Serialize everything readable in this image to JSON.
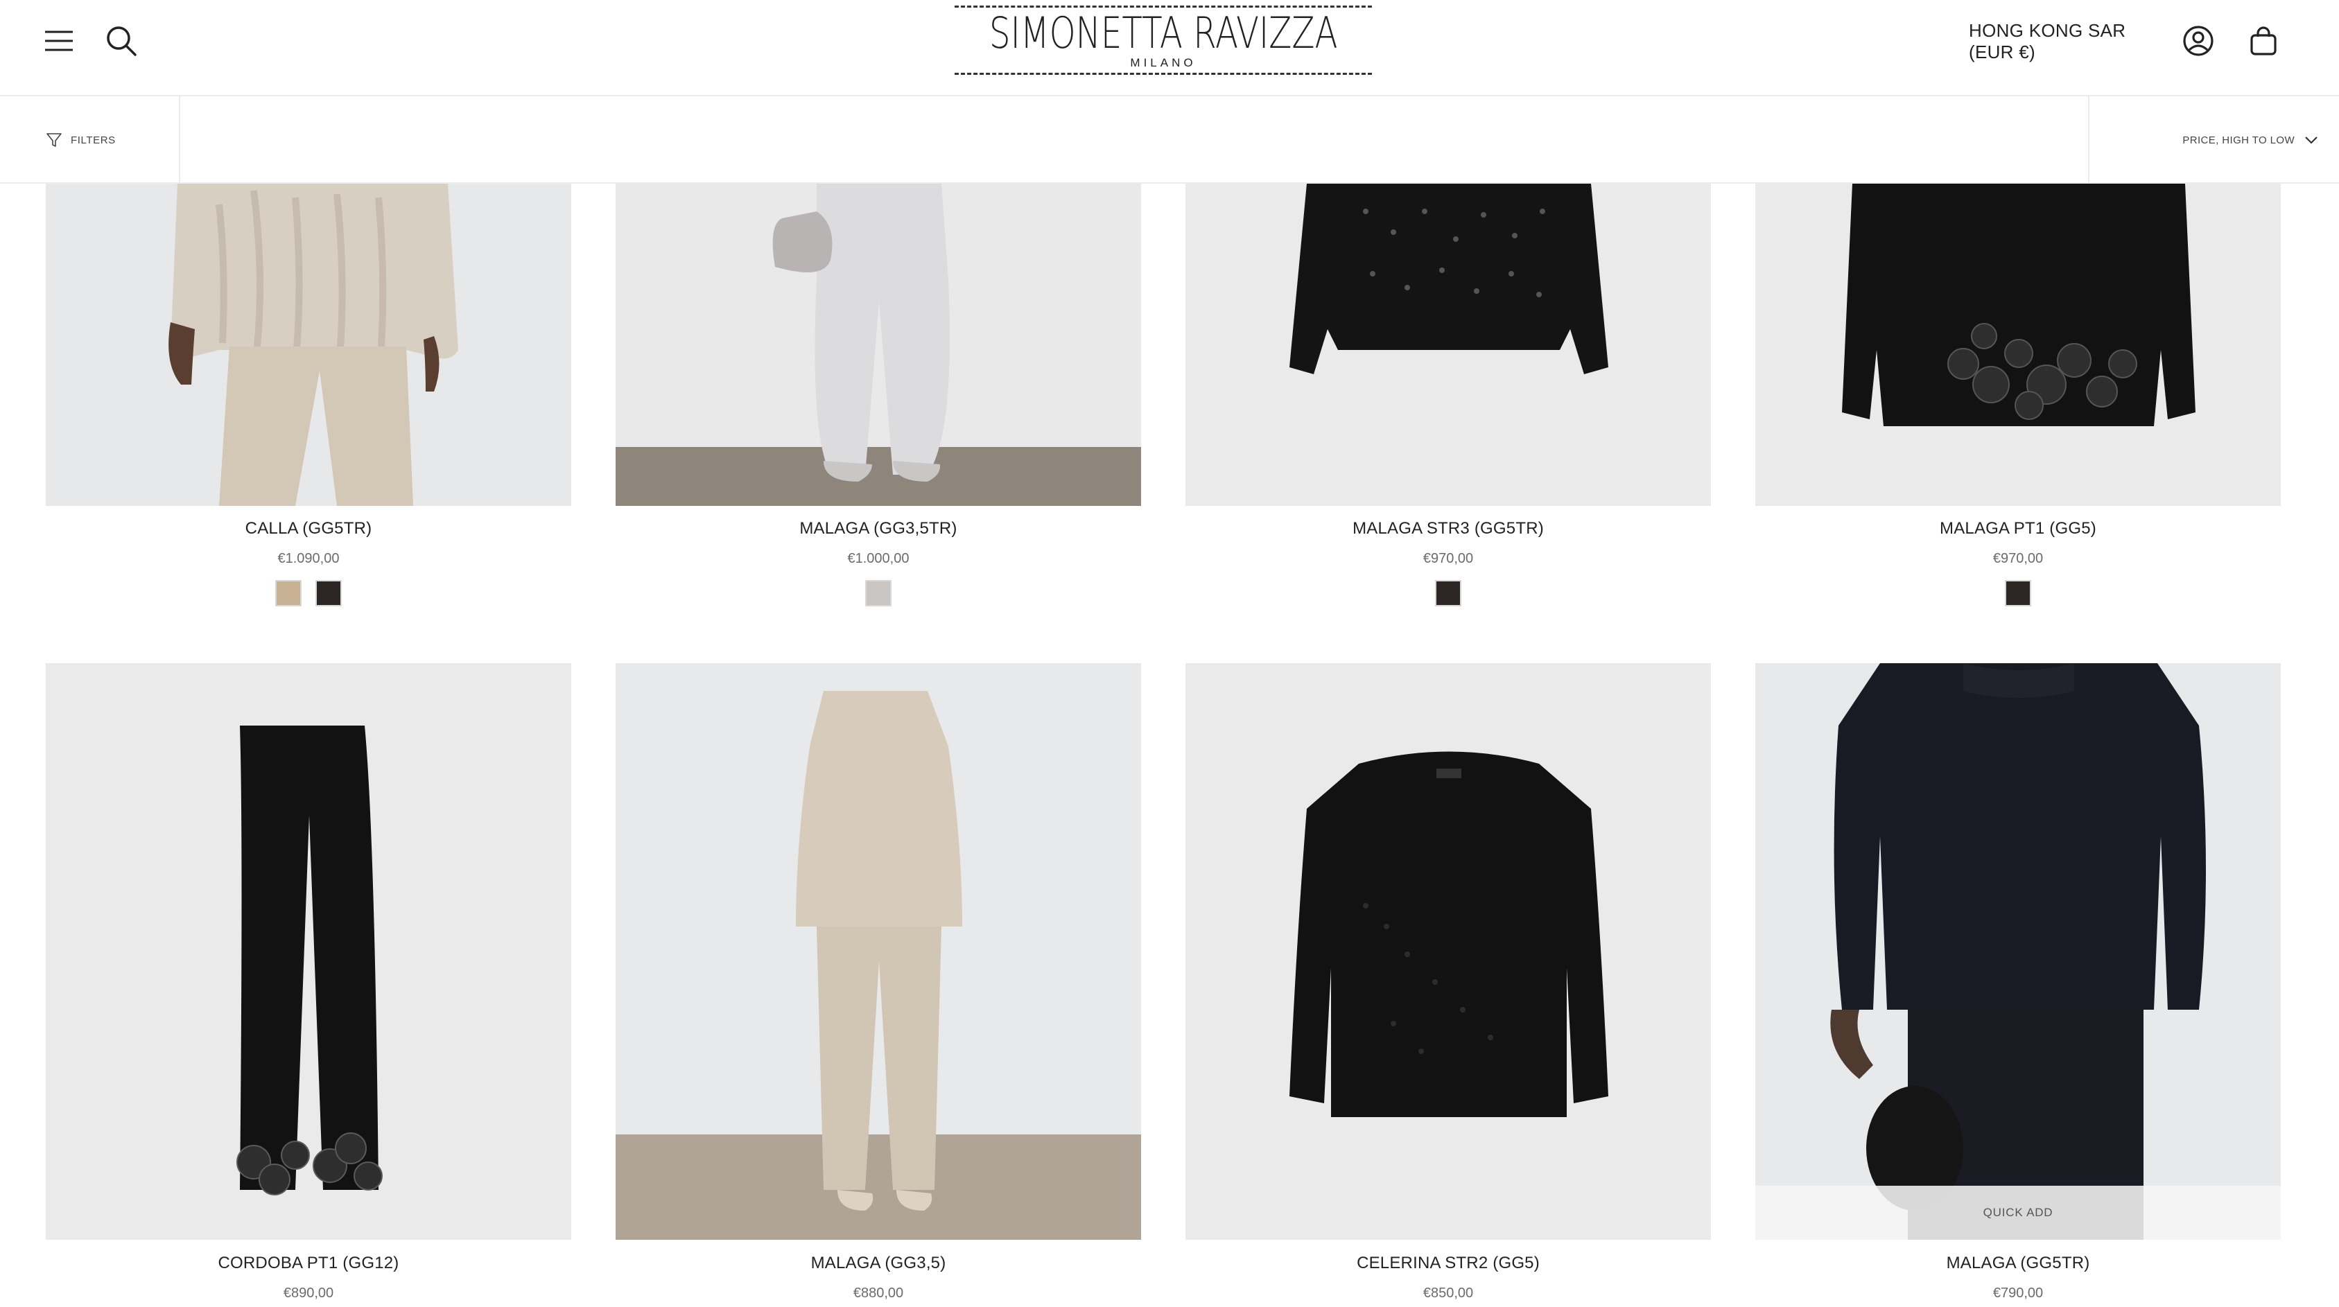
{
  "header": {
    "logo_main": "SIMONETTA RAVIZZA",
    "logo_sub": "MILANO",
    "region": "HONG KONG SAR (EUR €)",
    "icons": [
      "menu-icon",
      "search-icon",
      "account-icon",
      "cart-icon"
    ]
  },
  "toolbar": {
    "filters_label": "FILTERS",
    "sort_label": "PRICE, HIGH TO LOW"
  },
  "products": [
    {
      "name": "CALLA (GG5TR)",
      "price": "€1.090,00",
      "swatches": [
        "#c8b293",
        "#2b2623"
      ]
    },
    {
      "name": "MALAGA (GG3,5TR)",
      "price": "€1.000,00",
      "swatches": [
        "#c9c6c3"
      ]
    },
    {
      "name": "MALAGA STR3 (GG5TR)",
      "price": "€970,00",
      "swatches": [
        "#2b2623"
      ]
    },
    {
      "name": "MALAGA PT1 (GG5)",
      "price": "€970,00",
      "swatches": [
        "#2b2623"
      ]
    },
    {
      "name": "CORDOBA PT1 (GG12)",
      "price": "€890,00",
      "swatches": []
    },
    {
      "name": "MALAGA (GG3,5)",
      "price": "€880,00",
      "swatches": []
    },
    {
      "name": "CELERINA STR2 (GG5)",
      "price": "€850,00",
      "swatches": []
    },
    {
      "name": "MALAGA (GG5TR)",
      "price": "€790,00",
      "swatches": [],
      "quick_add": "QUICK ADD"
    }
  ],
  "colors": {
    "text": "#222222",
    "price": "#6b6b6b",
    "image_bg": "#eaeaea",
    "divider": "#ececec"
  }
}
